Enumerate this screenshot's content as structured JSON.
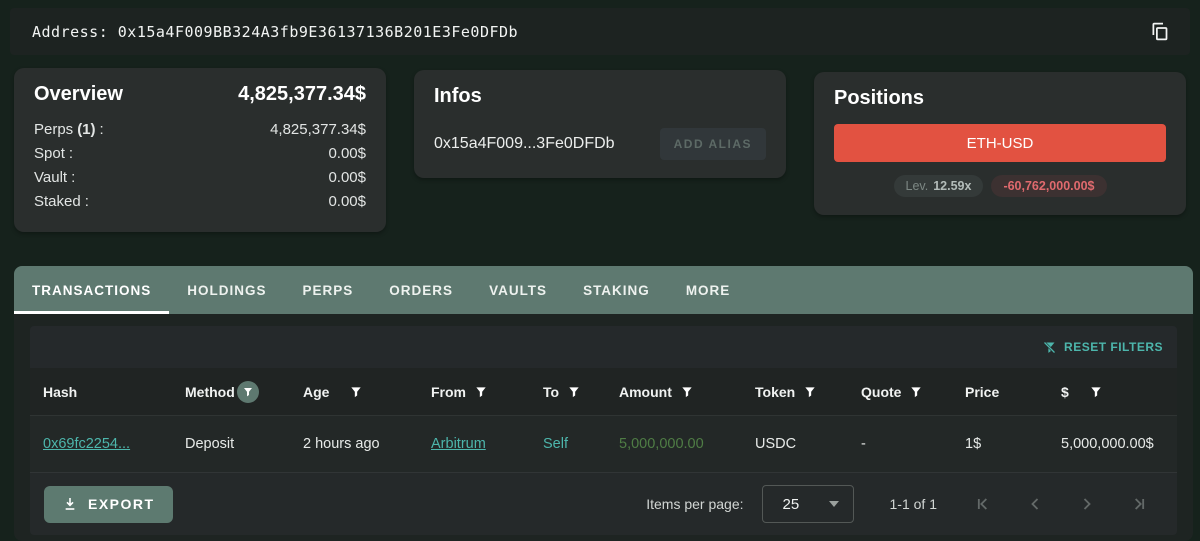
{
  "address_bar": {
    "label": "Address:",
    "value": "0x15a4F009BB324A3fb9E36137136B201E3Fe0DFDb"
  },
  "overview": {
    "title": "Overview",
    "total": "4,825,377.34$",
    "rows": [
      {
        "pre": "Perps",
        "bold": "(1)",
        "post": ":",
        "value": "4,825,377.34$"
      },
      {
        "pre": "Spot",
        "bold": "",
        "post": ":",
        "value": "0.00$"
      },
      {
        "pre": "Vault",
        "bold": "",
        "post": ":",
        "value": "0.00$"
      },
      {
        "pre": "Staked",
        "bold": "",
        "post": ":",
        "value": "0.00$"
      }
    ]
  },
  "infos": {
    "title": "Infos",
    "address_short": "0x15a4F009...3Fe0DFDb",
    "add_alias_label": "ADD ALIAS"
  },
  "positions": {
    "title": "Positions",
    "position_label": "ETH-USD",
    "lev_label": "Lev.",
    "lev_value": "12.59x",
    "pnl_value": "-60,762,000.00$"
  },
  "tabs": {
    "items": [
      {
        "label": "TRANSACTIONS",
        "active": true
      },
      {
        "label": "HOLDINGS",
        "active": false
      },
      {
        "label": "PERPS",
        "active": false
      },
      {
        "label": "ORDERS",
        "active": false
      },
      {
        "label": "VAULTS",
        "active": false
      },
      {
        "label": "STAKING",
        "active": false
      },
      {
        "label": "MORE",
        "active": false
      }
    ]
  },
  "table": {
    "reset_filters_label": "RESET FILTERS",
    "columns": [
      {
        "label": "Hash",
        "filter": false
      },
      {
        "label": "Method",
        "filter": true,
        "filter_active": true
      },
      {
        "label": "Age",
        "filter": true
      },
      {
        "label": "From",
        "filter": true
      },
      {
        "label": "To",
        "filter": true
      },
      {
        "label": "Amount",
        "filter": true
      },
      {
        "label": "Token",
        "filter": true
      },
      {
        "label": "Quote",
        "filter": true
      },
      {
        "label": "Price",
        "filter": false
      },
      {
        "label": "$",
        "filter": true
      }
    ],
    "rows": [
      {
        "hash": "0x69fc2254...",
        "method": "Deposit",
        "age": "2 hours ago",
        "from": "Arbitrum",
        "to": "Self",
        "amount": "5,000,000.00",
        "token": "USDC",
        "quote": "-",
        "price": "1$",
        "usd": "5,000,000.00$"
      }
    ]
  },
  "footer": {
    "export_label": "EXPORT",
    "items_per_page_label": "Items per page:",
    "items_per_page_value": "25",
    "range_label": "1-1 of 1"
  },
  "colors": {
    "accent_teal": "#4db6ac",
    "position_red": "#e25241",
    "amount_green": "#4f7d45",
    "pnl_pink": "#e06a6e",
    "tabbar_sage": "#5e7970"
  }
}
